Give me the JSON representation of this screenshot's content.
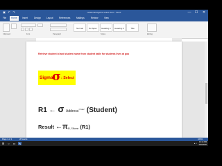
{
  "window": {
    "title": "relational algebra select.docx - Word",
    "minimize": "—",
    "maximize": "☐",
    "close": "✕"
  },
  "ribbon": {
    "tabs": [
      "File",
      "Home",
      "Insert",
      "Design",
      "Layout",
      "References",
      "Mailings",
      "Review",
      "View"
    ],
    "active_tab": "Home",
    "groups": [
      "Clipboard",
      "Font",
      "Paragraph",
      "Styles",
      "Editing"
    ],
    "styles": [
      "Normal",
      "No Spac.",
      "Heading 1",
      "Heading 2",
      "Title"
    ]
  },
  "document": {
    "instruction": "Retrieve student id and student name from student table for students lives at goa",
    "sigma_word": "Sigma",
    "sigma_symbol": "σ",
    "sigma_after": ": Select",
    "r1_label": "R1",
    "arrow": "←",
    "sigma_symbol2": "σ",
    "r1_attr": "Address",
    "r1_value": "='Alex'",
    "r1_relation": "(Student)",
    "result_label": "Result",
    "pi_symbol": "π",
    "result_sub": "ID, SName",
    "result_relation": "(R1)"
  },
  "status": {
    "page": "Page 1 of 1",
    "words": "28 words",
    "zoom": "100%"
  },
  "taskbar": {
    "time": "10:14 PM",
    "date": "3/30/2020"
  },
  "colors": {
    "word_blue": "#2b579a",
    "instruction_red": "#d22020",
    "highlight_yellow": "#ffff00"
  }
}
